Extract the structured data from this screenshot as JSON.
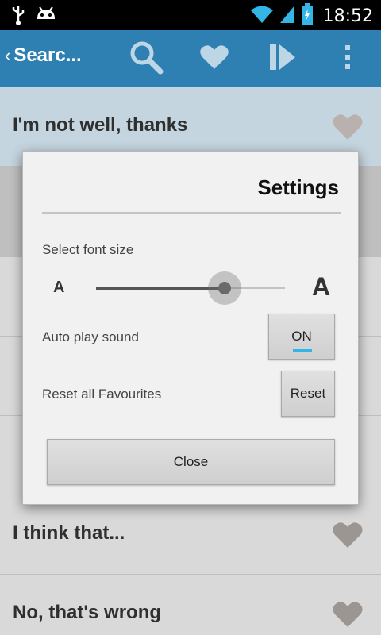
{
  "statusbar": {
    "time": "18:52",
    "icons": [
      "usb-icon",
      "android-debug-icon",
      "wifi-icon",
      "signal-icon",
      "battery-charging-icon"
    ]
  },
  "actionbar": {
    "title": "Searc...",
    "actions": [
      "search-icon",
      "heart-icon",
      "play-icon",
      "overflow-menu-icon"
    ]
  },
  "list": {
    "items": [
      {
        "text": "I'm not well, thanks"
      },
      {
        "text": "I think that..."
      },
      {
        "text": "No, that's wrong"
      }
    ]
  },
  "dialog": {
    "title": "Settings",
    "font_size_label": "Select font size",
    "font_small": "A",
    "font_big": "A",
    "font_slider_value": 0.68,
    "auto_play_label": "Auto play sound",
    "auto_play_state": "ON",
    "reset_label": "Reset all Favourites",
    "reset_button": "Reset",
    "close_button": "Close"
  },
  "colors": {
    "actionbar": "#2e7fb2",
    "toggle_accent": "#33b5e5"
  }
}
